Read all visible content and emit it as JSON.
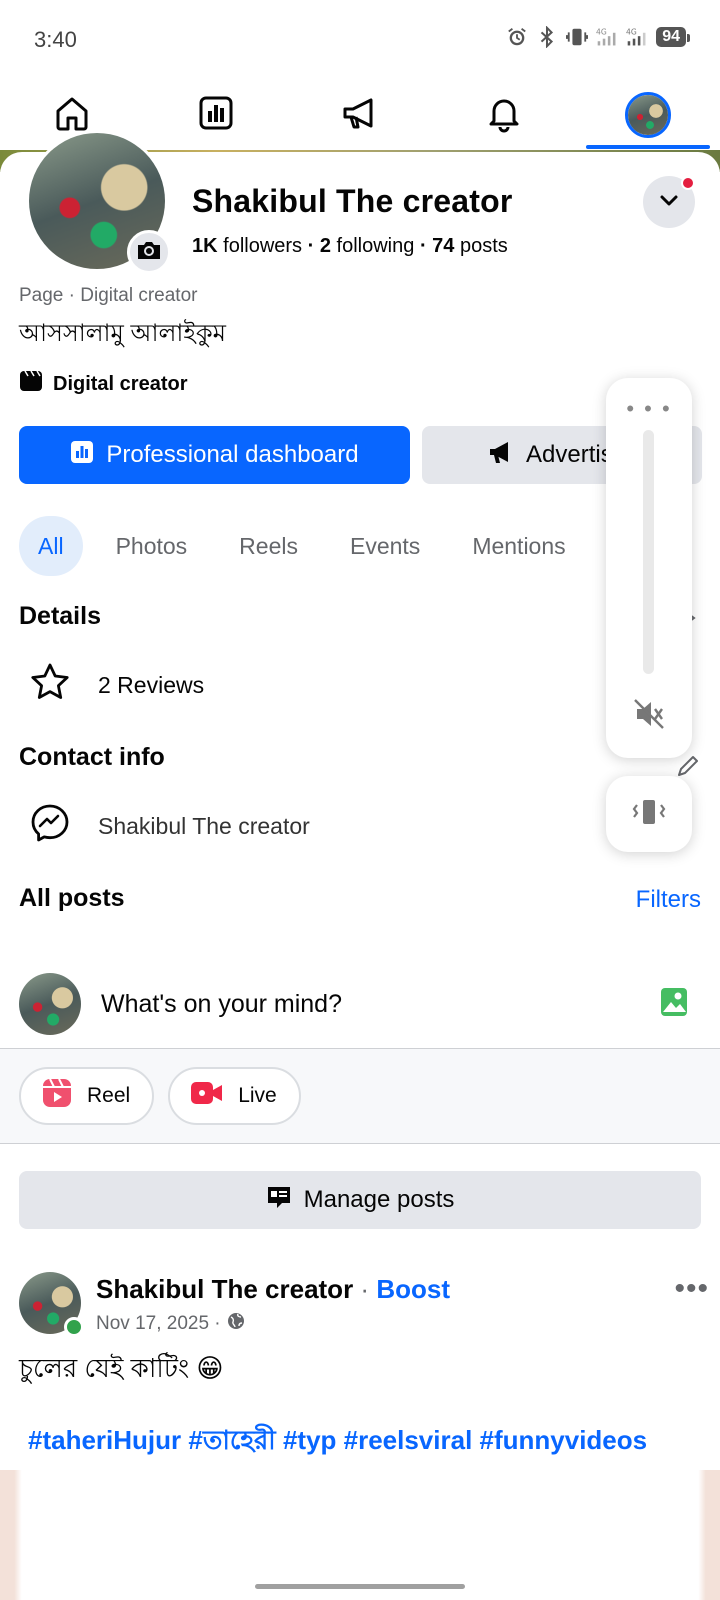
{
  "status_bar": {
    "time": "3:40",
    "network_1": "4G",
    "network_2": "4G",
    "battery": "94"
  },
  "top_nav": {
    "tabs": [
      "home-icon",
      "dashboard-icon",
      "megaphone-icon",
      "bell-icon",
      "profile-avatar"
    ],
    "active_index": 4
  },
  "profile": {
    "name": "Shakibul The creator",
    "followers_count": "1K",
    "followers_label": "followers",
    "following_count": "2",
    "following_label": "following",
    "posts_count": "74",
    "posts_label": "posts",
    "sep": "·",
    "page_category": "Page · Digital creator",
    "bio": "আসসালামু আলাইকুম",
    "category_label": "Digital creator"
  },
  "actions": {
    "primary_label": "Professional dashboard",
    "secondary_label": "Advertise"
  },
  "filter_tabs": [
    "All",
    "Photos",
    "Reels",
    "Events",
    "Mentions"
  ],
  "details": {
    "title": "Details",
    "reviews": "2 Reviews"
  },
  "contact": {
    "title": "Contact info",
    "messenger": "Shakibul The creator"
  },
  "posts_section": {
    "title": "All posts",
    "filters_label": "Filters",
    "composer_placeholder": "What's on your mind?",
    "reel_label": "Reel",
    "live_label": "Live",
    "manage_label": "Manage posts"
  },
  "post": {
    "author": "Shakibul The creator",
    "boost_sep": "·",
    "boost_label": "Boost",
    "date": "Nov 17, 2025 ·",
    "text": "চুলের যেই কাটিং 😁",
    "hashtags": "#taheriHujur #তাহেরী #typ #reelsviral #funnyvideos"
  },
  "volume_overlay": {
    "menu_dots": "• • •"
  },
  "colors": {
    "brand_blue": "#0866ff",
    "chip_active_bg": "#e2edfb",
    "secondary_button_bg": "#e4e6eb",
    "notification_red": "#e41e3f",
    "online_green": "#31a24c"
  }
}
